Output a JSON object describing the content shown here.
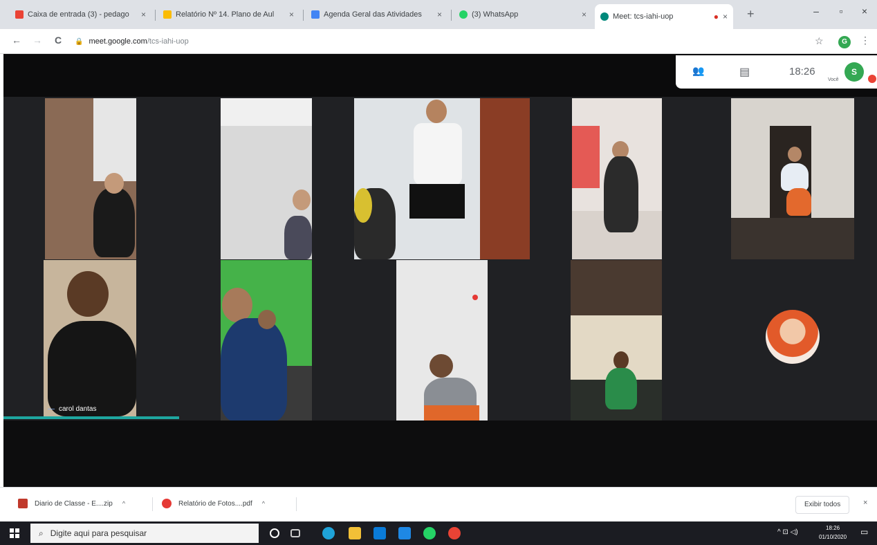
{
  "browser": {
    "tabs": [
      {
        "title": "Caixa de entrada (3) - pedago",
        "favicon_color": "#ea4335",
        "active": false
      },
      {
        "title": "Relatório Nº 14. Plano de Aul",
        "favicon_color": "#fbbc04",
        "active": false
      },
      {
        "title": "Agenda Geral das Atividades",
        "favicon_color": "#4285f4",
        "active": false
      },
      {
        "title": "(3) WhatsApp",
        "favicon_color": "#25d366",
        "active": false
      },
      {
        "title": "Meet: tcs-iahi-uop",
        "favicon_color": "#00897b",
        "active": true
      }
    ],
    "tab_close": "×",
    "new_tab": "+",
    "window_controls": {
      "minimize": "–",
      "maximize": "▫",
      "close": "×"
    },
    "nav": {
      "back": "←",
      "forward": "→",
      "reload": "C"
    },
    "url": {
      "host": "meet.google.com",
      "path": "/tcs-iahi-uop"
    },
    "bookmark": "☆",
    "profile_initial": "G",
    "menu": "⋮"
  },
  "meet": {
    "time": "18:26",
    "user_initial": "S",
    "user_label": "Você",
    "people_icon": "👥",
    "chat_icon": "▤",
    "active_speaker_name": "carol dantas",
    "accent": "#1ea7a0"
  },
  "downloads": {
    "items": [
      {
        "label": "Diario de Classe - E....zip",
        "icon_color": "#c0392b"
      },
      {
        "label": "Relatório de Fotos....pdf",
        "icon_color": "#e53935"
      }
    ],
    "chevron": "^",
    "show_all": "Exibir todos",
    "close": "×"
  },
  "taskbar": {
    "search_placeholder": "Digite aqui para pesquisar",
    "clock_time": "18:26",
    "clock_date": "01/10/2020",
    "tray": "^ ⊡ ◁)",
    "notifications": "▭"
  }
}
